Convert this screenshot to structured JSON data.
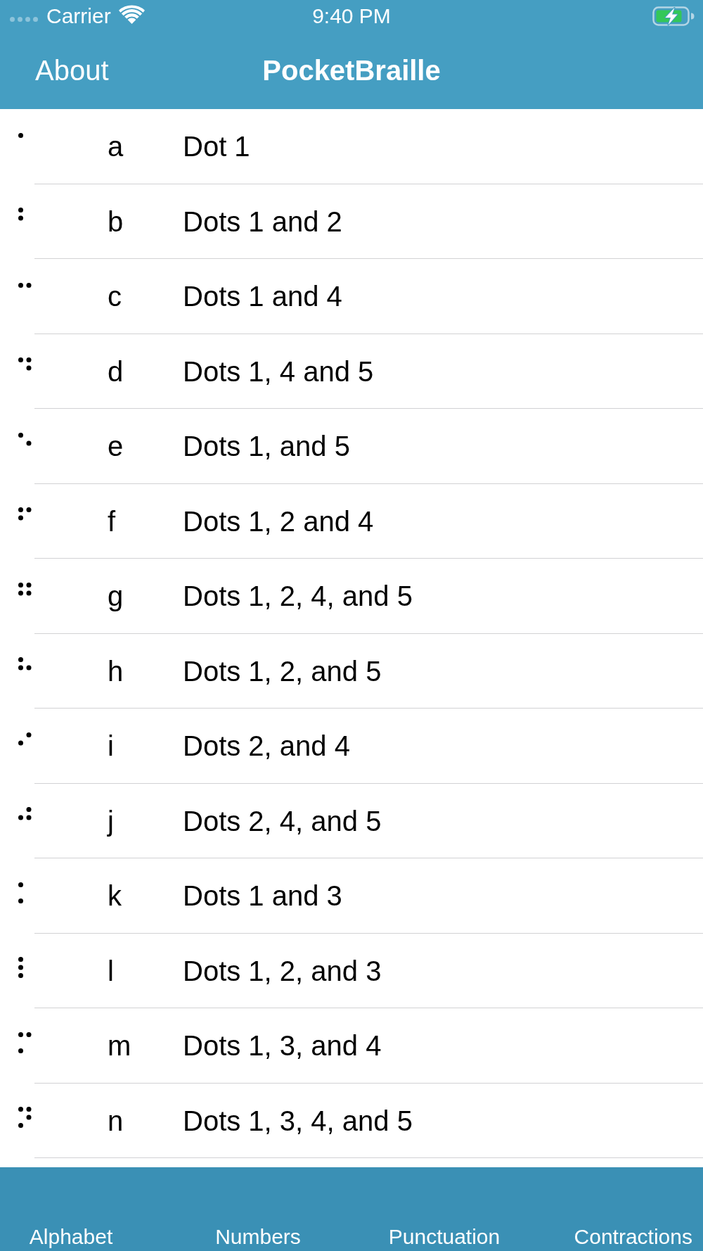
{
  "status_bar": {
    "carrier": "Carrier",
    "time": "9:40 PM"
  },
  "nav_bar": {
    "left_button": "About",
    "title": "PocketBraille"
  },
  "rows": [
    {
      "dots": [
        true,
        false,
        false,
        false,
        false,
        false
      ],
      "letter": "a",
      "description": "Dot 1"
    },
    {
      "dots": [
        true,
        true,
        false,
        false,
        false,
        false
      ],
      "letter": "b",
      "description": "Dots 1 and 2"
    },
    {
      "dots": [
        true,
        false,
        false,
        true,
        false,
        false
      ],
      "letter": "c",
      "description": "Dots 1 and 4"
    },
    {
      "dots": [
        true,
        false,
        false,
        true,
        true,
        false
      ],
      "letter": "d",
      "description": "Dots 1, 4 and 5"
    },
    {
      "dots": [
        true,
        false,
        false,
        false,
        true,
        false
      ],
      "letter": "e",
      "description": "Dots 1, and 5"
    },
    {
      "dots": [
        true,
        true,
        false,
        true,
        false,
        false
      ],
      "letter": "f",
      "description": "Dots 1, 2 and 4"
    },
    {
      "dots": [
        true,
        true,
        false,
        true,
        true,
        false
      ],
      "letter": "g",
      "description": "Dots 1, 2, 4, and 5"
    },
    {
      "dots": [
        true,
        true,
        false,
        false,
        true,
        false
      ],
      "letter": "h",
      "description": "Dots 1, 2, and 5"
    },
    {
      "dots": [
        false,
        true,
        false,
        true,
        false,
        false
      ],
      "letter": "i",
      "description": "Dots 2, and 4"
    },
    {
      "dots": [
        false,
        true,
        false,
        true,
        true,
        false
      ],
      "letter": "j",
      "description": "Dots 2, 4, and 5"
    },
    {
      "dots": [
        true,
        false,
        true,
        false,
        false,
        false
      ],
      "letter": "k",
      "description": "Dots 1 and 3"
    },
    {
      "dots": [
        true,
        true,
        true,
        false,
        false,
        false
      ],
      "letter": "l",
      "description": "Dots 1, 2, and 3"
    },
    {
      "dots": [
        true,
        false,
        true,
        true,
        false,
        false
      ],
      "letter": "m",
      "description": "Dots 1, 3, and 4"
    },
    {
      "dots": [
        true,
        false,
        true,
        true,
        true,
        false
      ],
      "letter": "n",
      "description": "Dots 1, 3, 4, and 5"
    }
  ],
  "tab_bar": {
    "tabs": [
      {
        "label": "Alphabet"
      },
      {
        "label": "Numbers"
      },
      {
        "label": "Punctuation"
      },
      {
        "label": "Contractions"
      }
    ]
  }
}
